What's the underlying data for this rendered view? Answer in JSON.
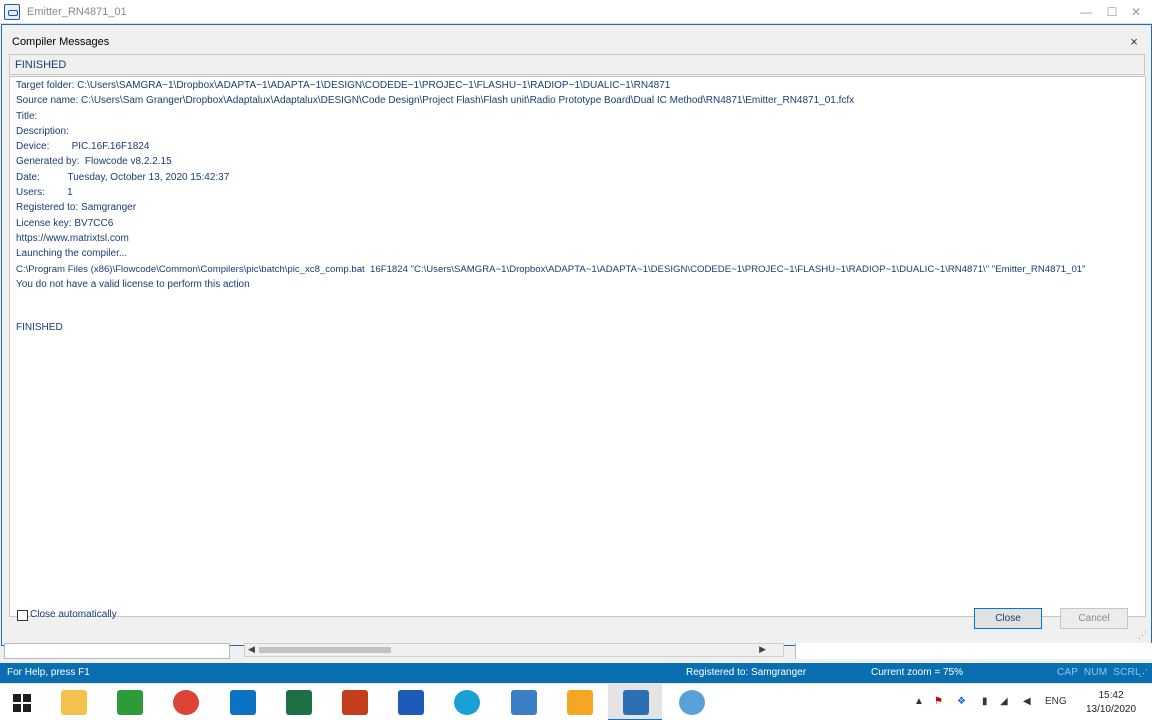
{
  "window": {
    "title": "Emitter_RN4871_01",
    "minimize_glyph": "—",
    "maximize_glyph": "☐",
    "close_glyph": "✕"
  },
  "dialog": {
    "title": "Compiler Messages",
    "close_glyph": "×",
    "status": "FINISHED",
    "lines": [
      "Target folder: C:\\Users\\SAMGRA~1\\Dropbox\\ADAPTA~1\\ADAPTA~1\\DESIGN\\CODEDE~1\\PROJEC~1\\FLASHU~1\\RADIOP~1\\DUALIC~1\\RN4871",
      "Source name:   C:\\Users\\Sam Granger\\Dropbox\\Adaptalux\\Adaptalux\\DESIGN\\Code Design\\Project Flash\\Flash unit\\Radio Prototype Board\\Dual IC Method\\RN4871\\Emitter_RN4871_01.fcfx",
      "Title:",
      "Description:",
      "Device:        PIC.16F.16F1824",
      "Generated by:  Flowcode v8.2.2.15",
      "Date:          Tuesday, October 13, 2020 15:42:37",
      "Users:        1",
      "Registered to: Samgranger",
      "License key: BV7CC6",
      "https://www.matrixtsl.com",
      "Launching the compiler...",
      "C:\\Program Files (x86)\\Flowcode\\Common\\Compilers\\pic\\batch\\pic_xc8_comp.bat  16F1824 \"C:\\Users\\SAMGRA~1\\Dropbox\\ADAPTA~1\\ADAPTA~1\\DESIGN\\CODEDE~1\\PROJEC~1\\FLASHU~1\\RADIOP~1\\DUALIC~1\\RN4871\\\" \"Emitter_RN4871_01\"",
      "You do not have a valid license to perform this action"
    ],
    "finished_line": "FINISHED",
    "close_automatically_label": "Close automatically",
    "close_automatically_checked": false,
    "close_button": "Close",
    "cancel_button": "Cancel"
  },
  "scrollbar": {
    "left_arrow": "◀",
    "right_arrow": "▶"
  },
  "statusbar": {
    "help": "For Help, press F1",
    "registered": "Registered to: Samgranger",
    "zoom": "Current zoom = 75%",
    "keys": "CAP  NUM  SCRL"
  },
  "taskbar": {
    "apps": [
      {
        "name": "file-explorer",
        "color": "#f2c14e"
      },
      {
        "name": "microsoft-store",
        "color": "#2d9b3a"
      },
      {
        "name": "chrome",
        "color": "#db4437"
      },
      {
        "name": "mail",
        "color": "#0b72c6"
      },
      {
        "name": "excel",
        "color": "#1d7044"
      },
      {
        "name": "powerpoint",
        "color": "#c43e1c"
      },
      {
        "name": "word",
        "color": "#1e5bb8"
      },
      {
        "name": "edge",
        "color": "#1aa0d6"
      },
      {
        "name": "control-panel",
        "color": "#3b7fc4"
      },
      {
        "name": "presentation-app",
        "color": "#f5a623"
      },
      {
        "name": "flowcode",
        "color": "#2c6fb5"
      },
      {
        "name": "paint",
        "color": "#5aa0d8"
      }
    ],
    "tray": {
      "chevron": "▲",
      "language": "ENG",
      "time": "15:42",
      "date": "13/10/2020"
    }
  }
}
